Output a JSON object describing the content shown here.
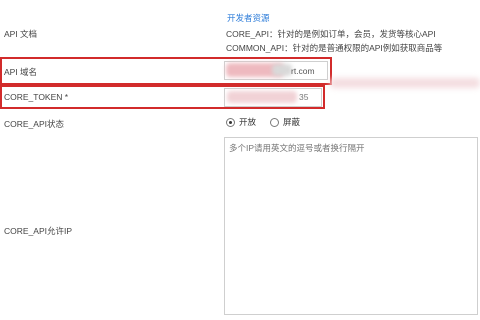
{
  "fields": {
    "api_doc": {
      "label": "API 文档",
      "link": "开发者资源",
      "lines": [
        "CORE_API：针对的是例如订单，会员，发货等核心API",
        "COMMON_API：针对的是普通权限的API例如获取商品等"
      ]
    },
    "api_domain": {
      "label": "API 域名",
      "value_visible_suffix": "rt.com"
    },
    "core_token": {
      "label": "CORE_TOKEN *",
      "value_visible_suffix": "35"
    },
    "core_api_status": {
      "label": "CORE_API状态",
      "options": [
        "开放",
        "屏蔽"
      ],
      "selected": "开放"
    },
    "core_api_allowed_ip": {
      "label": "CORE_API允许IP",
      "placeholder": "多个IP请用英文的逗号或者换行隔开"
    }
  },
  "colors": {
    "highlight_border": "#d22b2b",
    "link": "#2b7bd9",
    "redaction": "#f0c8cc"
  }
}
